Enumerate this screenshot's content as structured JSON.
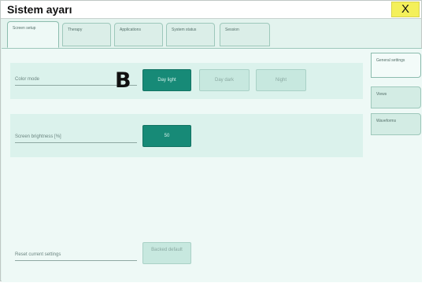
{
  "window": {
    "title": "Sistem ayarı",
    "close_label": "X"
  },
  "top_tabs": [
    {
      "label": "Screen setup",
      "active": true
    },
    {
      "label": "Therapy",
      "active": false
    },
    {
      "label": "Applications",
      "active": false
    },
    {
      "label": "System status",
      "active": false
    },
    {
      "label": "Session",
      "active": false
    }
  ],
  "side_tabs": [
    {
      "label": "General settings",
      "active": true
    },
    {
      "label": "Views",
      "active": false
    },
    {
      "label": "Waveforms",
      "active": false
    }
  ],
  "color_mode": {
    "label": "Color mode",
    "options": [
      {
        "label": "Day light",
        "selected": true
      },
      {
        "label": "Day dark",
        "selected": false
      },
      {
        "label": "Night",
        "selected": false
      }
    ]
  },
  "brightness": {
    "label": "Screen brightness [%]",
    "value": "50"
  },
  "reset": {
    "label": "Reset current settings",
    "button_label": "Backed default"
  },
  "overlay": {
    "letter": "B"
  },
  "colors": {
    "accent": "#178a77",
    "background": "#e3f3ee",
    "close": "#f4f05a"
  }
}
